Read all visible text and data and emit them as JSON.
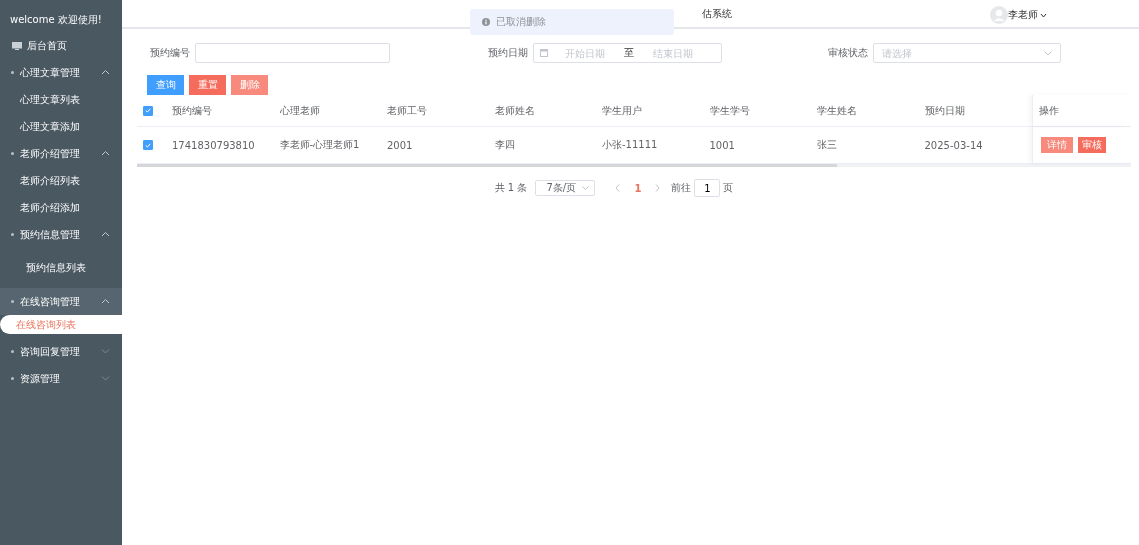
{
  "sidebar": {
    "welcome": "welcome 欢迎使用!",
    "items": [
      {
        "kind": "link",
        "label": "后台首页"
      },
      {
        "kind": "group",
        "label": "心理文章管理",
        "expanded": true,
        "children": [
          {
            "label": "心理文章列表",
            "selected": false
          },
          {
            "label": "心理文章添加",
            "selected": false
          }
        ]
      },
      {
        "kind": "group",
        "label": "老师介绍管理",
        "expanded": true,
        "children": [
          {
            "label": "老师介绍列表",
            "selected": false
          },
          {
            "label": "老师介绍添加",
            "selected": false
          }
        ]
      },
      {
        "kind": "group",
        "label": "预约信息管理",
        "expanded": true,
        "children": [
          {
            "label": "预约信息列表",
            "selected": false
          }
        ]
      },
      {
        "kind": "group",
        "label": "在线咨询管理",
        "expanded": true,
        "hovered": true,
        "children": [
          {
            "label": "在线咨询列表",
            "selected": true
          }
        ]
      },
      {
        "kind": "group",
        "label": "咨询回复管理",
        "expanded": false
      },
      {
        "kind": "group",
        "label": "资源管理",
        "expanded": false
      }
    ]
  },
  "header": {
    "title": "估系统",
    "user": "李老师"
  },
  "toast": {
    "message": "已取消删除"
  },
  "filters": {
    "booking_no": {
      "label": "预约编号"
    },
    "date": {
      "label": "预约日期",
      "start_placeholder": "开始日期",
      "separator": "至",
      "end_placeholder": "结束日期"
    },
    "status": {
      "label": "审核状态",
      "placeholder": "请选择"
    }
  },
  "actions": [
    {
      "label": "查询",
      "kind": "primary"
    },
    {
      "label": "重置",
      "kind": "danger"
    },
    {
      "label": "删除",
      "kind": "light"
    }
  ],
  "table": {
    "all_checked": true,
    "columns": [
      "预约编号",
      "心理老师",
      "老师工号",
      "老师姓名",
      "学生用户",
      "学生学号",
      "学生姓名",
      "预约日期"
    ],
    "action_column": "操作",
    "rows": [
      {
        "checked": true,
        "cells": [
          "1741830793810",
          "李老师-心理老师1",
          "2001",
          "李四",
          "小张-11111",
          "1001",
          "张三",
          "2025-03-14"
        ],
        "buttons": [
          {
            "label": "详情",
            "kind": "light"
          },
          {
            "label": "审核",
            "kind": "danger"
          }
        ]
      }
    ]
  },
  "pagination": {
    "total": "共 1 条",
    "page_size": "7条/页",
    "pages": [
      {
        "label": "1",
        "selected": true
      }
    ],
    "goto_label": "前往",
    "goto_value": "1",
    "page_suffix": "页"
  }
}
